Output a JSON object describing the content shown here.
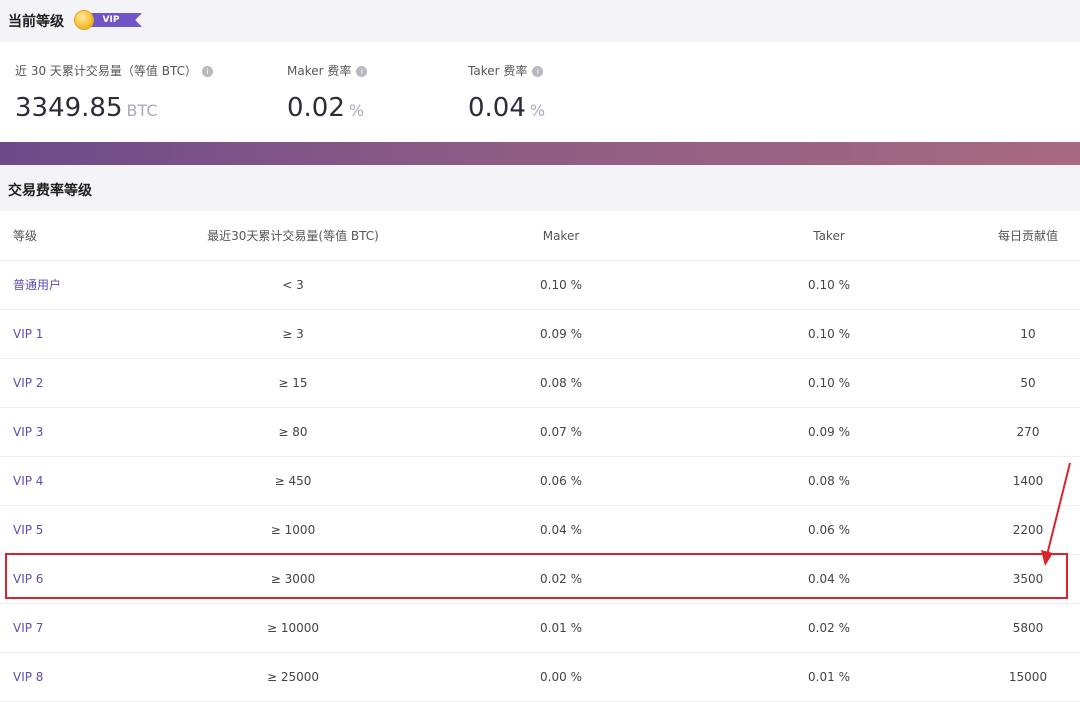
{
  "header": {
    "title": "当前等级",
    "badge_label": "VIP"
  },
  "stats": [
    {
      "label": "近 30 天累计交易量（等值 BTC）",
      "value": "3349.85",
      "unit": "BTC",
      "info_icon": "info-icon"
    },
    {
      "label": "Maker 费率",
      "value": "0.02",
      "unit": "%",
      "info_icon": "info-icon"
    },
    {
      "label": "Taker 费率",
      "value": "0.04",
      "unit": "%",
      "info_icon": "info-icon"
    }
  ],
  "fee_section": {
    "title": "交易费率等级"
  },
  "table": {
    "headers": [
      "等级",
      "最近30天累计交易量(等值 BTC)",
      "Maker",
      "Taker",
      "每日贡献值"
    ],
    "rows": [
      {
        "level": "普通用户",
        "volume": "< 3",
        "maker": "0.10 %",
        "taker": "0.10 %",
        "contribution": ""
      },
      {
        "level": "VIP 1",
        "volume": "≥ 3",
        "maker": "0.09 %",
        "taker": "0.10 %",
        "contribution": "10"
      },
      {
        "level": "VIP 2",
        "volume": "≥ 15",
        "maker": "0.08 %",
        "taker": "0.10 %",
        "contribution": "50"
      },
      {
        "level": "VIP 3",
        "volume": "≥ 80",
        "maker": "0.07 %",
        "taker": "0.09 %",
        "contribution": "270"
      },
      {
        "level": "VIP 4",
        "volume": "≥ 450",
        "maker": "0.06 %",
        "taker": "0.08 %",
        "contribution": "1400"
      },
      {
        "level": "VIP 5",
        "volume": "≥ 1000",
        "maker": "0.04 %",
        "taker": "0.06 %",
        "contribution": "2200"
      },
      {
        "level": "VIP 6",
        "volume": "≥ 3000",
        "maker": "0.02 %",
        "taker": "0.04 %",
        "contribution": "3500"
      },
      {
        "level": "VIP 7",
        "volume": "≥ 10000",
        "maker": "0.01 %",
        "taker": "0.02 %",
        "contribution": "5800"
      },
      {
        "level": "VIP 8",
        "volume": "≥ 25000",
        "maker": "0.00 %",
        "taker": "0.01 %",
        "contribution": "15000"
      }
    ]
  },
  "colors": {
    "level_text": "#5b4fb0",
    "highlight": "#d9232d",
    "banner_start": "#6d4a8a",
    "banner_end": "#a86a80"
  }
}
